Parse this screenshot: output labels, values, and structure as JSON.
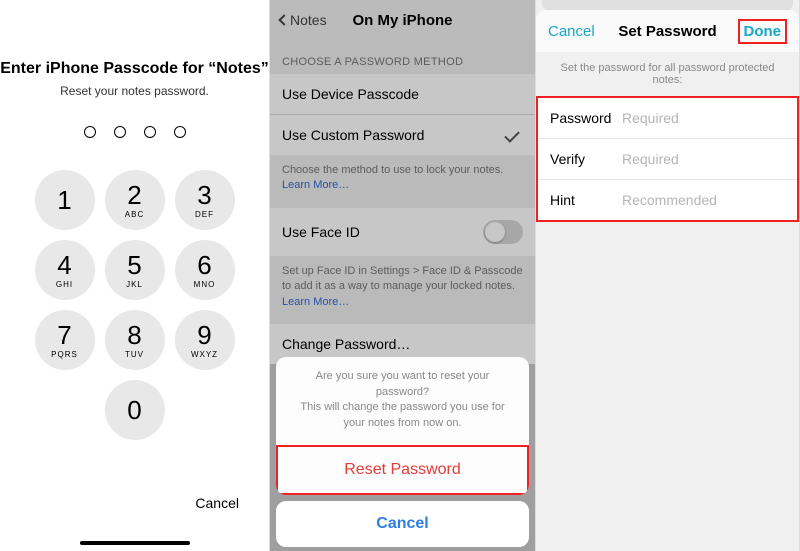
{
  "panel1": {
    "title": "Enter iPhone Passcode for “Notes”",
    "subtitle": "Reset your notes password.",
    "dotCount": 4,
    "keypad": [
      {
        "num": "1",
        "letters": ""
      },
      {
        "num": "2",
        "letters": "ABC"
      },
      {
        "num": "3",
        "letters": "DEF"
      },
      {
        "num": "4",
        "letters": "GHI"
      },
      {
        "num": "5",
        "letters": "JKL"
      },
      {
        "num": "6",
        "letters": "MNO"
      },
      {
        "num": "7",
        "letters": "PQRS"
      },
      {
        "num": "8",
        "letters": "TUV"
      },
      {
        "num": "9",
        "letters": "WXYZ"
      },
      {
        "num": "",
        "letters": ""
      },
      {
        "num": "0",
        "letters": ""
      },
      {
        "num": "",
        "letters": ""
      }
    ],
    "cancel": "Cancel"
  },
  "panel2": {
    "backLabel": "Notes",
    "navTitle": "On My iPhone",
    "sectionHeader": "CHOOSE A PASSWORD METHOD",
    "methodRows": [
      {
        "label": "Use Device Passcode",
        "selected": false
      },
      {
        "label": "Use Custom Password",
        "selected": true
      }
    ],
    "methodFooter": "Choose the method to use to lock your notes. ",
    "learnMore": "Learn More…",
    "faceIdLabel": "Use Face ID",
    "faceIdFooter": "Set up Face ID in Settings > Face ID & Passcode to add it as a way to manage your locked notes. ",
    "changePassword": "Change Password…",
    "sheet": {
      "message1": "Are you sure you want to reset your password?",
      "message2": "This will change the password you use for your notes from now on.",
      "reset": "Reset Password",
      "cancel": "Cancel"
    }
  },
  "panel3": {
    "cancel": "Cancel",
    "title": "Set Password",
    "done": "Done",
    "subtitle": "Set the password for all password protected notes:",
    "rows": [
      {
        "label": "Password",
        "placeholder": "Required"
      },
      {
        "label": "Verify",
        "placeholder": "Required"
      },
      {
        "label": "Hint",
        "placeholder": "Recommended"
      }
    ]
  },
  "colors": {
    "iosBlue": "#2f7de0",
    "iosRed": "#e63b3b",
    "teal": "#18a7c7",
    "highlightRed": "#e22"
  }
}
